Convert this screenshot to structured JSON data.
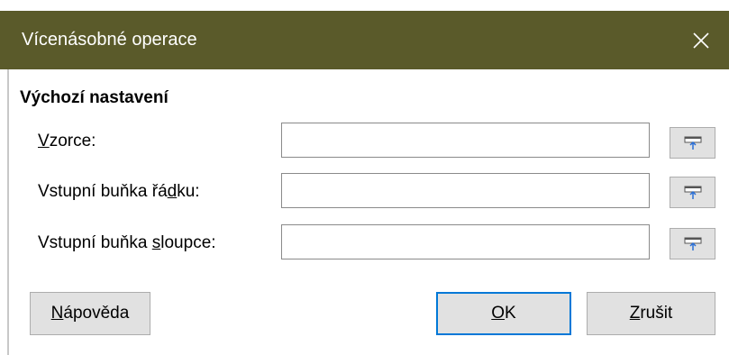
{
  "window": {
    "title": "Vícenásobné operace"
  },
  "section": {
    "heading": "Výchozí nastavení"
  },
  "rows": [
    {
      "label_pre": "",
      "label_key": "V",
      "label_post": "zorce:",
      "value": ""
    },
    {
      "label_pre": "Vstupní buňka řá",
      "label_key": "d",
      "label_post": "ku:",
      "value": ""
    },
    {
      "label_pre": "Vstupní buňka ",
      "label_key": "s",
      "label_post": "loupce:",
      "value": ""
    }
  ],
  "buttons": {
    "help": {
      "key": "N",
      "rest": "ápověda"
    },
    "ok": {
      "key": "O",
      "rest": "K"
    },
    "cancel": {
      "key": "Z",
      "rest": "rušit"
    }
  },
  "colors": {
    "titlebar": "#5a5a2a",
    "default_button_border": "#0078d7"
  },
  "icons": {
    "close": "close-icon",
    "shrink": "shrink-icon"
  }
}
